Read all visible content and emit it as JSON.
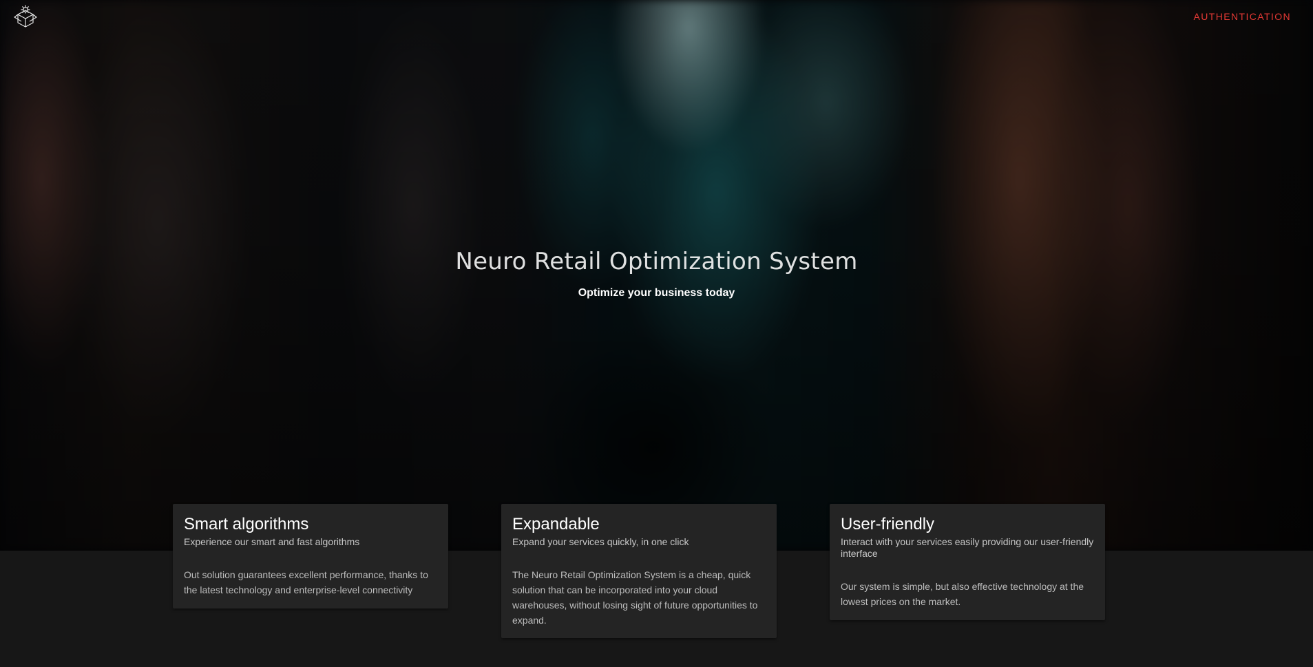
{
  "header": {
    "logo_icon": "box-network-icon",
    "auth_label": "AUTHENTICATION",
    "accent_color": "#e53935"
  },
  "hero": {
    "title": "Neuro Retail Optimization System",
    "subtitle": "Optimize your business today"
  },
  "features": [
    {
      "title": "Smart algorithms",
      "subtitle": "Experience our smart and fast algorithms",
      "text": "Out solution guarantees excellent performance, thanks to the latest technology and enterprise-level connectivity"
    },
    {
      "title": "Expandable",
      "subtitle": "Expand your services quickly, in one click",
      "text": "The Neuro Retail Optimization System is a cheap, quick solution that can be incorporated into your cloud warehouses, without losing sight of future opportunities to expand."
    },
    {
      "title": "User-friendly",
      "subtitle": "Interact with your services easily providing our user-friendly interface",
      "text": "Our system is simple, but also effective technology at the lowest prices on the market."
    }
  ]
}
